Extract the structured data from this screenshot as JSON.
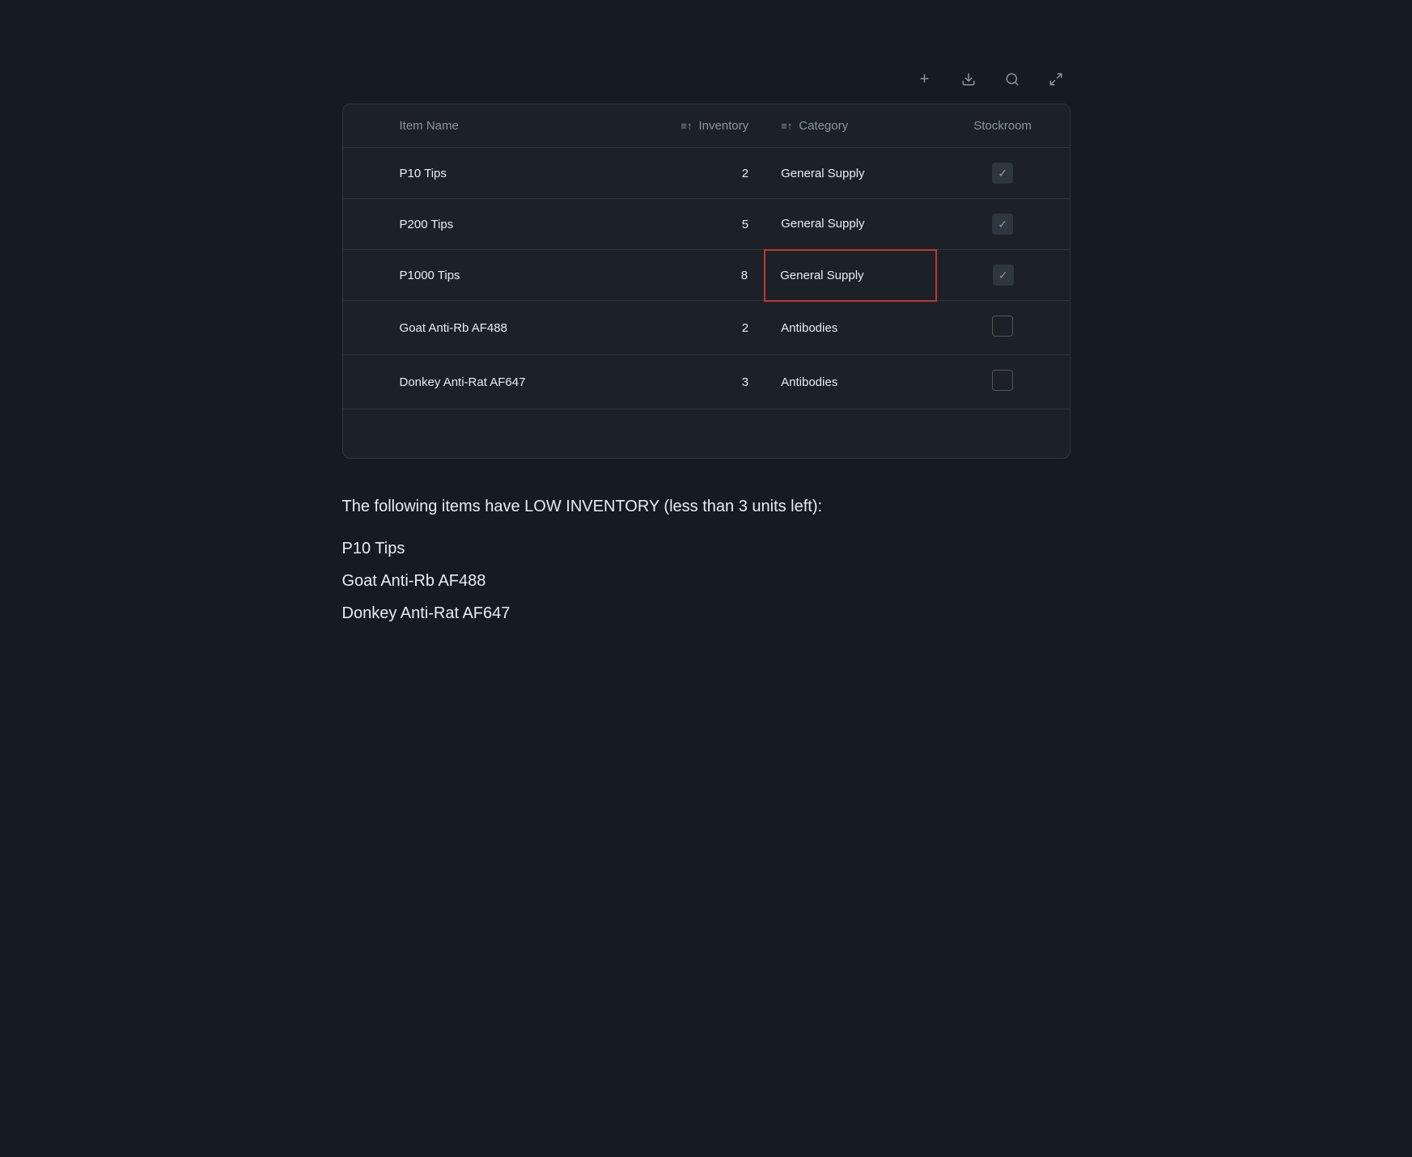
{
  "toolbar": {
    "add_label": "+",
    "download_label": "⬇",
    "search_label": "🔍",
    "expand_label": "⛶"
  },
  "table": {
    "columns": [
      {
        "key": "row_num",
        "label": ""
      },
      {
        "key": "item_name",
        "label": "Item Name",
        "sortable": true
      },
      {
        "key": "inventory",
        "label": "Inventory",
        "sortable": true
      },
      {
        "key": "category",
        "label": "Category",
        "sortable": true
      },
      {
        "key": "stockroom",
        "label": "Stockroom"
      }
    ],
    "rows": [
      {
        "row_num": "",
        "item_name": "P10 Tips",
        "inventory": "2",
        "category": "General Supply",
        "stockroom": true,
        "highlighted": false
      },
      {
        "row_num": "",
        "item_name": "P200 Tips",
        "inventory": "5",
        "category": "General Supply",
        "stockroom": true,
        "highlighted": false
      },
      {
        "row_num": "",
        "item_name": "P1000 Tips",
        "inventory": "8",
        "category": "General Supply",
        "stockroom": true,
        "highlighted": true
      },
      {
        "row_num": "",
        "item_name": "Goat Anti-Rb AF488",
        "inventory": "2",
        "category": "Antibodies",
        "stockroom": false,
        "highlighted": false
      },
      {
        "row_num": "",
        "item_name": "Donkey Anti-Rat AF647",
        "inventory": "3",
        "category": "Antibodies",
        "stockroom": false,
        "highlighted": false
      },
      {
        "row_num": "",
        "item_name": "",
        "inventory": "",
        "category": "",
        "stockroom": null,
        "highlighted": false
      }
    ]
  },
  "low_inventory": {
    "title": "The following items have LOW INVENTORY (less than 3 units left):",
    "items": [
      "P10 Tips",
      "Goat Anti-Rb AF488",
      "Donkey Anti-Rat AF647"
    ]
  }
}
